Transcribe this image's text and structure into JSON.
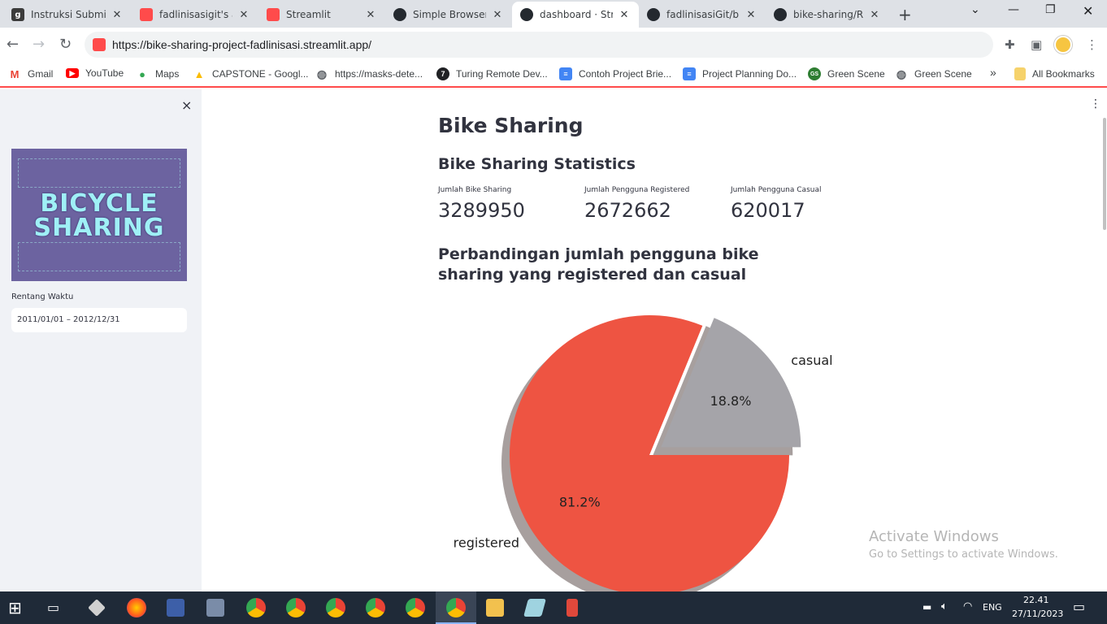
{
  "browser": {
    "tabs": [
      {
        "title": "Instruksi Submis",
        "icon_color": "#3b3b3b",
        "icon_text": "g"
      },
      {
        "title": "fadlinisasigit's ap",
        "icon_color": "#ff4b4b",
        "icon_text": ""
      },
      {
        "title": "Streamlit",
        "icon_color": "#ff4b4b",
        "icon_text": ""
      },
      {
        "title": "Simple Browser",
        "icon_color": "#24292f",
        "icon_text": ""
      },
      {
        "title": "dashboard · Stre",
        "icon_color": "#24292f",
        "icon_text": ""
      },
      {
        "title": "fadlinisasiGit/bik",
        "icon_color": "#24292f",
        "icon_text": ""
      },
      {
        "title": "bike-sharing/RE",
        "icon_color": "#24292f",
        "icon_text": ""
      }
    ],
    "active_tab_index": 4,
    "new_tab_label": "+",
    "url": "https://bike-sharing-project-fadlinisasi.streamlit.app/",
    "bookmarks": [
      {
        "label": "Gmail",
        "icon_color": "#ea4335",
        "icon_text": "M"
      },
      {
        "label": "YouTube",
        "icon_color": "#ff0000",
        "icon_text": "▶"
      },
      {
        "label": "Maps",
        "icon_color": "#34a853",
        "icon_text": "●"
      },
      {
        "label": "CAPSTONE - Googl...",
        "icon_color": "#fbbc04",
        "icon_text": "▲"
      },
      {
        "label": "https://masks-dete...",
        "icon_color": "#5f6368",
        "icon_text": "◍"
      },
      {
        "label": "Turing Remote Dev...",
        "icon_color": "#202124",
        "icon_text": "7"
      },
      {
        "label": "Contoh Project Brie...",
        "icon_color": "#4285f4",
        "icon_text": "≡"
      },
      {
        "label": "Project Planning Do...",
        "icon_color": "#4285f4",
        "icon_text": "≡"
      },
      {
        "label": "Green Scene",
        "icon_color": "#2e7d32",
        "icon_text": "GS"
      },
      {
        "label": "Green Scene",
        "icon_color": "#5f6368",
        "icon_text": "◍"
      }
    ],
    "more_bookmarks": "»",
    "all_bookmarks": "All Bookmarks"
  },
  "sidebar": {
    "close_label": "×",
    "logo_line1": "BICYCLE",
    "logo_line2": "SHARING",
    "date_label": "Rentang Waktu",
    "date_value": "2011/01/01 – 2012/12/31"
  },
  "main": {
    "title": "Bike Sharing",
    "stats_title": "Bike Sharing Statistics",
    "metrics": [
      {
        "label": "Jumlah Bike Sharing",
        "value": "3289950"
      },
      {
        "label": "Jumlah Pengguna Registered",
        "value": "2672662"
      },
      {
        "label": "Jumlah Pengguna Casual",
        "value": "620017"
      }
    ],
    "chart_title": "Perbandingan jumlah pengguna bike sharing yang registered dan casual"
  },
  "chart_data": {
    "type": "pie",
    "categories": [
      "casual",
      "registered"
    ],
    "values": [
      18.8,
      81.2
    ],
    "pct_labels": [
      "18.8%",
      "81.2%"
    ],
    "colors": [
      "#a5a4a9",
      "#ee5442"
    ],
    "explode": [
      0.1,
      0
    ],
    "shadow": true
  },
  "watermark": {
    "line1": "Activate Windows",
    "line2": "Go to Settings to activate Windows."
  },
  "taskbar": {
    "language": "ENG",
    "time": "22.41",
    "date": "27/11/2023"
  }
}
